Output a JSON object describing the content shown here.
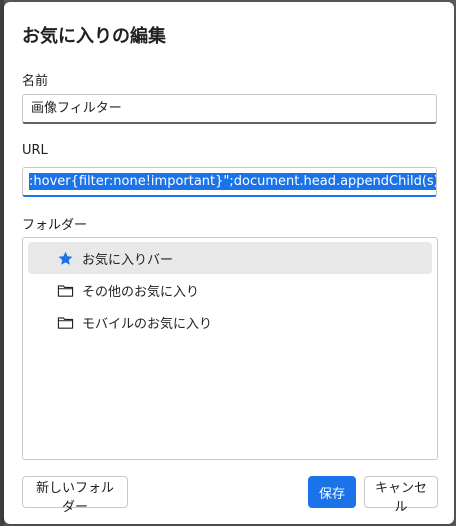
{
  "dialog": {
    "title": "お気に入りの編集",
    "name_label": "名前",
    "name_value": "画像フィルター",
    "url_label": "URL",
    "url_value": ":hover{filter:none!important}\";document.head.appendChild(s)})();",
    "folder_label": "フォルダー",
    "folders": [
      {
        "label": "お気に入りバー",
        "icon": "star-icon",
        "selected": true
      },
      {
        "label": "その他のお気に入り",
        "icon": "folder-icon",
        "selected": false
      },
      {
        "label": "モバイルのお気に入り",
        "icon": "folder-icon",
        "selected": false
      }
    ],
    "buttons": {
      "new_folder": "新しいフォルダー",
      "save": "保存",
      "cancel": "キャンセル"
    }
  },
  "colors": {
    "accent": "#1a73e8",
    "selection_bg": "#e8e8e8"
  }
}
